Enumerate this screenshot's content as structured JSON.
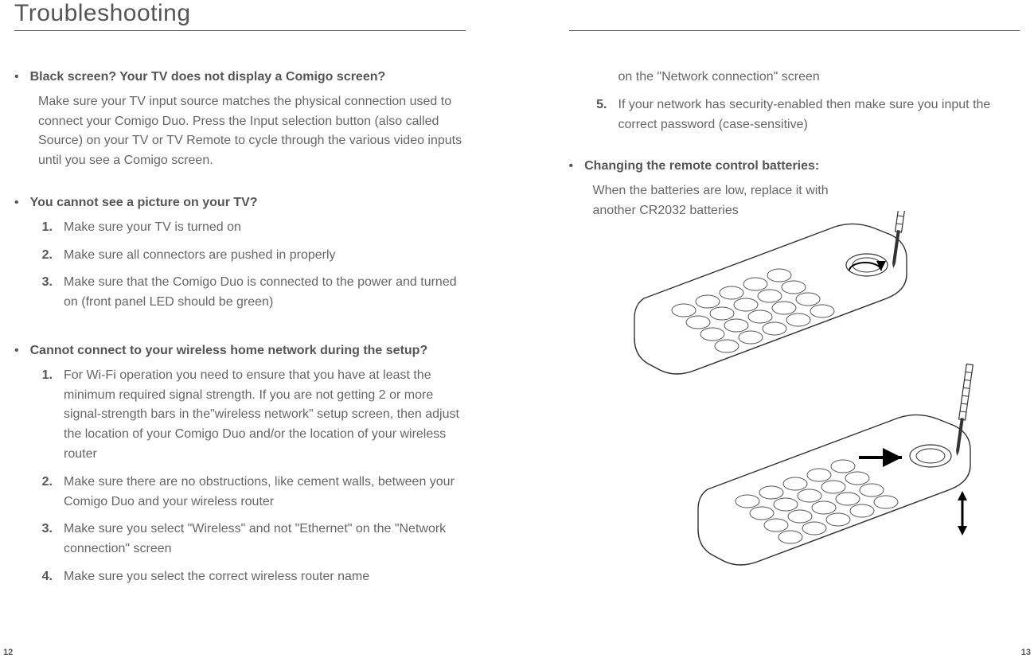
{
  "title": "Troubleshooting",
  "left": {
    "s1": {
      "title": "Black screen? Your TV does not display a Comigo screen?",
      "body": "Make sure your TV input source matches the physical connection used to connect your Comigo Duo. Press the Input selection button (also called Source) on your TV or TV Remote to cycle through the various video inputs until you see a Comigo screen."
    },
    "s2": {
      "title": "You cannot see a picture on your TV?",
      "items": [
        "Make sure your TV is turned on",
        "Make sure all connectors are pushed in properly",
        "Make sure that the Comigo Duo is connected to the power and turned on (front panel LED should be green)"
      ]
    },
    "s3": {
      "title": "Cannot connect to your wireless home network during the setup?",
      "items": [
        "For Wi-Fi operation you need to ensure that you have at least the minimum required signal strength. If you are not getting 2 or more signal-strength bars in the\"wireless network\" setup screen, then adjust the location of your Comigo Duo and/or the location of your wireless router",
        "Make sure there are no obstructions, like cement walls, between your Comigo Duo and your wireless router",
        "Make sure you select \"Wireless\" and not \"Ethernet\" on the \"Network connection\" screen",
        "Make sure you select the correct wireless router name"
      ]
    }
  },
  "right": {
    "cont": "on the \"Network connection\" screen",
    "s3_item5_num": "5.",
    "s3_item5": "If your network has security-enabled then make sure you input the correct password (case-sensitive)",
    "s4": {
      "title": "Changing the remote control batteries:",
      "body": "When the batteries are low, replace it with another CR2032 batteries"
    }
  },
  "nums": {
    "n1": "1.",
    "n2": "2.",
    "n3": "3.",
    "n4": "4."
  },
  "page_left": "12",
  "page_right": "13"
}
